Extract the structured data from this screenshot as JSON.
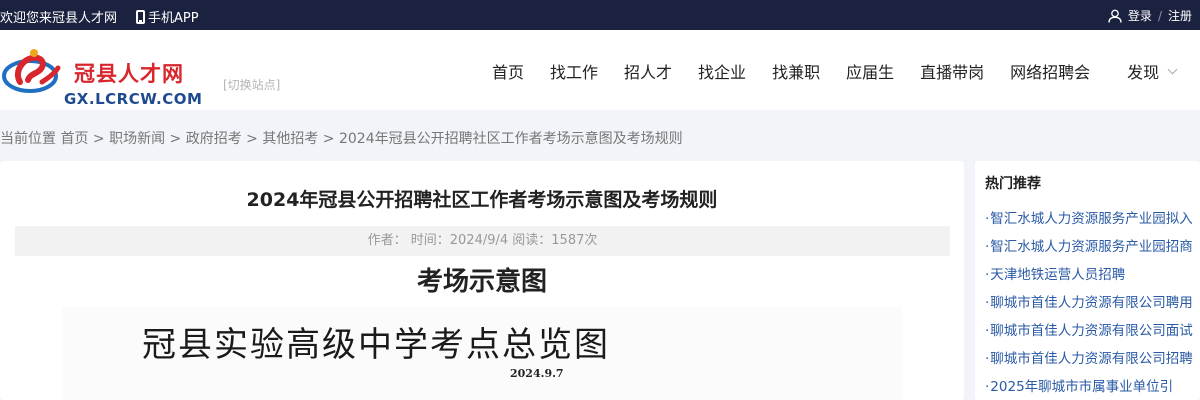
{
  "topbar": {
    "welcome": "欢迎您来冠县人才网",
    "app_label": "手机APP",
    "login": "登录",
    "separator": "/",
    "register": "注册"
  },
  "header": {
    "logo_cn": "冠县人才网",
    "logo_en": "GX.LCRCW.COM",
    "switch_site": "[切换站点]",
    "nav": [
      "首页",
      "找工作",
      "招人才",
      "找企业",
      "找兼职",
      "应届生",
      "直播带岗",
      "网络招聘会"
    ],
    "discover": "发现"
  },
  "breadcrumb": "当前位置 首页 > 职场新闻 > 政府招考 > 其他招考 > 2024年冠县公开招聘社区工作者考场示意图及考场规则",
  "article": {
    "title": "2024年冠县公开招聘社区工作者考场示意图及考场规则",
    "meta": "作者：  时间：2024/9/4 阅读：1587次",
    "sub_heading": "考场示意图",
    "image_title": "冠县实验高级中学考点总览图",
    "image_date": "2024.9.7"
  },
  "sidebar": {
    "title": "热门推荐",
    "items": [
      "智汇水城人力资源服务产业园拟入",
      "智汇水城人力资源服务产业园招商",
      "天津地铁运营人员招聘",
      "聊城市首佳人力资源有限公司聘用",
      "聊城市首佳人力资源有限公司面试",
      "聊城市首佳人力资源有限公司招聘",
      "2025年聊城市市属事业单位引"
    ]
  },
  "colors": {
    "topbar_bg": "#1b2240",
    "logo_red": "#d8262d",
    "logo_blue": "#1f4a8f",
    "link_blue": "#2a5aa6",
    "page_bg": "#f2f4f9"
  },
  "icons": [
    "phone-icon",
    "user-icon",
    "chevron-down-icon",
    "logo-icon"
  ]
}
